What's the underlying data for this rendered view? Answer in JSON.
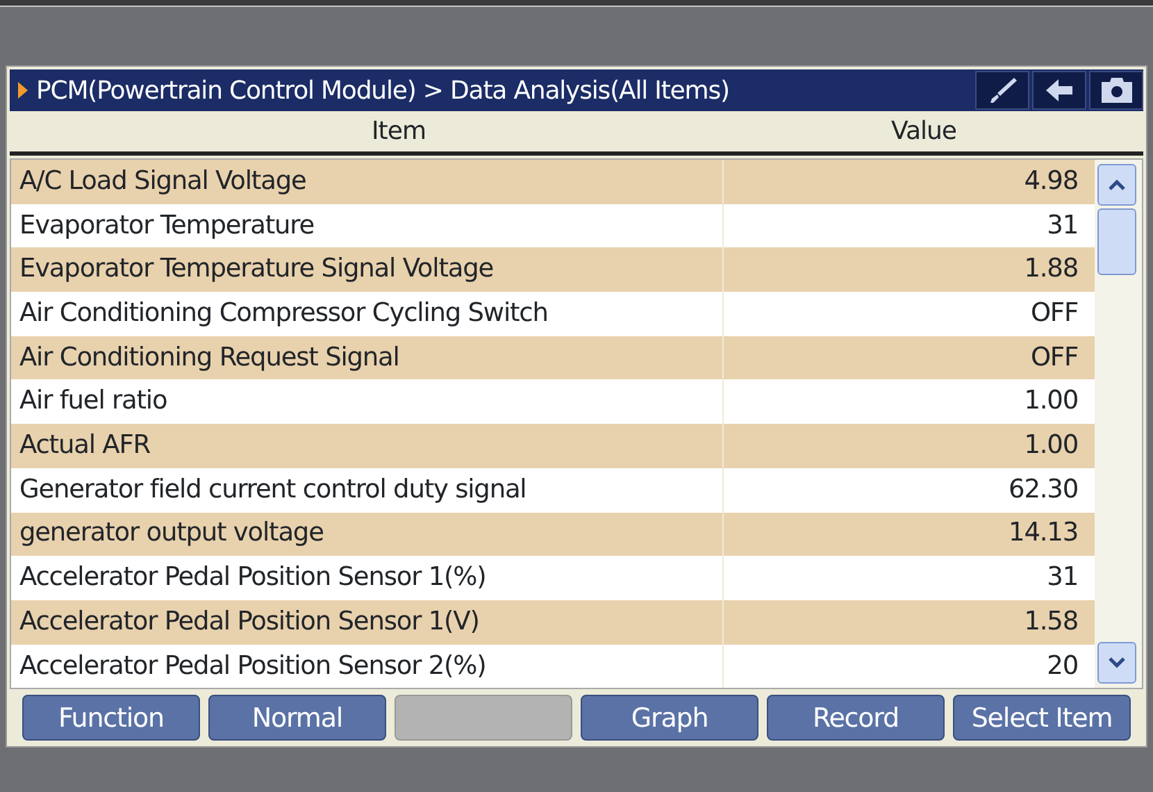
{
  "title_bar": {
    "breadcrumb": "PCM(Powertrain Control Module) > Data Analysis(All Items)"
  },
  "table": {
    "columns": [
      "Item",
      "Value"
    ],
    "rows": [
      {
        "item": "A/C Load Signal Voltage",
        "value": "4.98"
      },
      {
        "item": "Evaporator Temperature",
        "value": "31"
      },
      {
        "item": "Evaporator Temperature Signal Voltage",
        "value": "1.88"
      },
      {
        "item": "Air Conditioning Compressor Cycling Switch",
        "value": "OFF"
      },
      {
        "item": "Air Conditioning Request Signal",
        "value": "OFF"
      },
      {
        "item": "Air fuel ratio",
        "value": "1.00"
      },
      {
        "item": "Actual AFR",
        "value": "1.00"
      },
      {
        "item": "Generator field current control duty signal",
        "value": "62.30"
      },
      {
        "item": "generator output voltage",
        "value": "14.13"
      },
      {
        "item": "Accelerator Pedal Position Sensor 1(%)",
        "value": "31"
      },
      {
        "item": "Accelerator Pedal Position Sensor 1(V)",
        "value": "1.58"
      },
      {
        "item": "Accelerator Pedal Position Sensor 2(%)",
        "value": "20"
      }
    ]
  },
  "buttons": [
    {
      "label": "Function",
      "disabled": false
    },
    {
      "label": "Normal",
      "disabled": false
    },
    {
      "disabled": true
    },
    {
      "label": "Graph",
      "disabled": false
    },
    {
      "label": "Record",
      "disabled": false
    },
    {
      "label": "Select Item",
      "disabled": false
    }
  ]
}
